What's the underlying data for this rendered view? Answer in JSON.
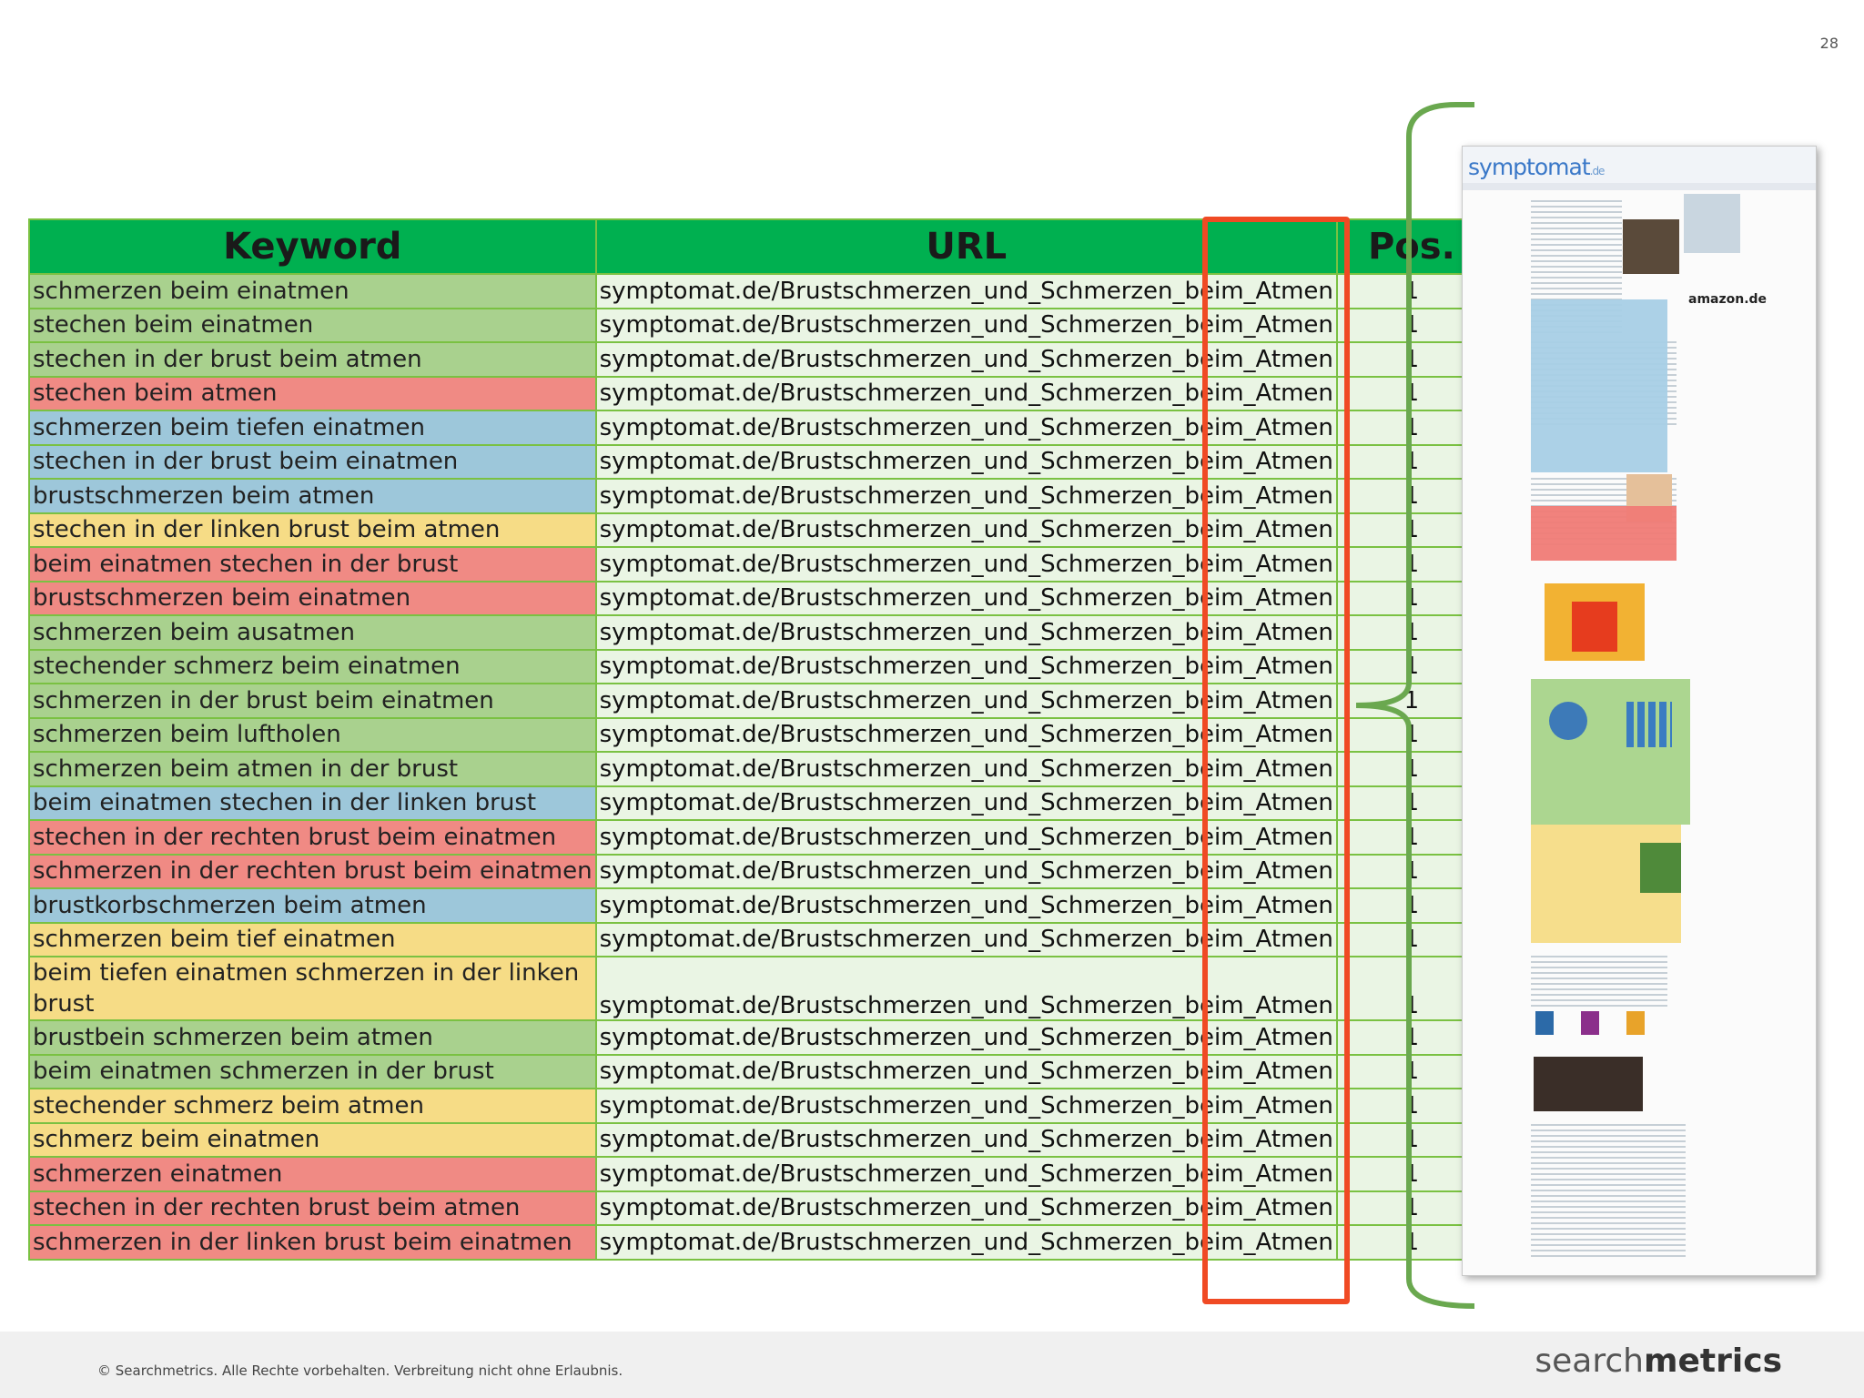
{
  "page_number": "28",
  "table": {
    "headers": {
      "keyword": "Keyword",
      "url": "URL",
      "pos": "Pos."
    },
    "rows": [
      {
        "keyword": "schmerzen beim einatmen",
        "url": "symptomat.de/Brustschmerzen_und_Schmerzen_beim_Atmen",
        "pos": "1",
        "color": "green"
      },
      {
        "keyword": "stechen beim einatmen",
        "url": "symptomat.de/Brustschmerzen_und_Schmerzen_beim_Atmen",
        "pos": "1",
        "color": "green"
      },
      {
        "keyword": "stechen in der brust beim atmen",
        "url": "symptomat.de/Brustschmerzen_und_Schmerzen_beim_Atmen",
        "pos": "1",
        "color": "green"
      },
      {
        "keyword": "stechen beim atmen",
        "url": "symptomat.de/Brustschmerzen_und_Schmerzen_beim_Atmen",
        "pos": "1",
        "color": "red"
      },
      {
        "keyword": "schmerzen beim tiefen einatmen",
        "url": "symptomat.de/Brustschmerzen_und_Schmerzen_beim_Atmen",
        "pos": "1",
        "color": "blue"
      },
      {
        "keyword": "stechen in der brust beim einatmen",
        "url": "symptomat.de/Brustschmerzen_und_Schmerzen_beim_Atmen",
        "pos": "1",
        "color": "blue"
      },
      {
        "keyword": "brustschmerzen beim atmen",
        "url": "symptomat.de/Brustschmerzen_und_Schmerzen_beim_Atmen",
        "pos": "1",
        "color": "blue"
      },
      {
        "keyword": "stechen in der linken brust beim atmen",
        "url": "symptomat.de/Brustschmerzen_und_Schmerzen_beim_Atmen",
        "pos": "1",
        "color": "yellow"
      },
      {
        "keyword": "beim einatmen stechen in der brust",
        "url": "symptomat.de/Brustschmerzen_und_Schmerzen_beim_Atmen",
        "pos": "1",
        "color": "red"
      },
      {
        "keyword": "brustschmerzen beim einatmen",
        "url": "symptomat.de/Brustschmerzen_und_Schmerzen_beim_Atmen",
        "pos": "1",
        "color": "red"
      },
      {
        "keyword": "schmerzen beim ausatmen",
        "url": "symptomat.de/Brustschmerzen_und_Schmerzen_beim_Atmen",
        "pos": "1",
        "color": "green"
      },
      {
        "keyword": "stechender schmerz beim einatmen",
        "url": "symptomat.de/Brustschmerzen_und_Schmerzen_beim_Atmen",
        "pos": "1",
        "color": "green"
      },
      {
        "keyword": "schmerzen in der brust beim einatmen",
        "url": "symptomat.de/Brustschmerzen_und_Schmerzen_beim_Atmen",
        "pos": "1",
        "color": "green"
      },
      {
        "keyword": "schmerzen beim luftholen",
        "url": "symptomat.de/Brustschmerzen_und_Schmerzen_beim_Atmen",
        "pos": "1",
        "color": "green"
      },
      {
        "keyword": "schmerzen beim atmen in der brust",
        "url": "symptomat.de/Brustschmerzen_und_Schmerzen_beim_Atmen",
        "pos": "1",
        "color": "green"
      },
      {
        "keyword": "beim einatmen stechen in der linken brust",
        "url": "symptomat.de/Brustschmerzen_und_Schmerzen_beim_Atmen",
        "pos": "1",
        "color": "blue"
      },
      {
        "keyword": "stechen in der rechten brust beim einatmen",
        "url": "symptomat.de/Brustschmerzen_und_Schmerzen_beim_Atmen",
        "pos": "1",
        "color": "red"
      },
      {
        "keyword": "schmerzen in der rechten brust beim einatmen",
        "url": "symptomat.de/Brustschmerzen_und_Schmerzen_beim_Atmen",
        "pos": "1",
        "color": "red"
      },
      {
        "keyword": "brustkorbschmerzen beim atmen",
        "url": "symptomat.de/Brustschmerzen_und_Schmerzen_beim_Atmen",
        "pos": "1",
        "color": "blue"
      },
      {
        "keyword": "schmerzen beim tief einatmen",
        "url": "symptomat.de/Brustschmerzen_und_Schmerzen_beim_Atmen",
        "pos": "1",
        "color": "yellow"
      },
      {
        "keyword": "beim tiefen einatmen schmerzen in der linken brust",
        "url": "symptomat.de/Brustschmerzen_und_Schmerzen_beim_Atmen",
        "pos": "1",
        "color": "yellow",
        "tall": true
      },
      {
        "keyword": "brustbein schmerzen beim atmen",
        "url": "symptomat.de/Brustschmerzen_und_Schmerzen_beim_Atmen",
        "pos": "1",
        "color": "green"
      },
      {
        "keyword": "beim einatmen schmerzen in der brust",
        "url": "symptomat.de/Brustschmerzen_und_Schmerzen_beim_Atmen",
        "pos": "1",
        "color": "green"
      },
      {
        "keyword": "stechender schmerz beim atmen",
        "url": "symptomat.de/Brustschmerzen_und_Schmerzen_beim_Atmen",
        "pos": "1",
        "color": "yellow"
      },
      {
        "keyword": "schmerz beim einatmen",
        "url": "symptomat.de/Brustschmerzen_und_Schmerzen_beim_Atmen",
        "pos": "1",
        "color": "yellow"
      },
      {
        "keyword": "schmerzen einatmen",
        "url": "symptomat.de/Brustschmerzen_und_Schmerzen_beim_Atmen",
        "pos": "1",
        "color": "red"
      },
      {
        "keyword": "stechen in der rechten brust beim atmen",
        "url": "symptomat.de/Brustschmerzen_und_Schmerzen_beim_Atmen",
        "pos": "1",
        "color": "red"
      },
      {
        "keyword": "schmerzen in der linken brust beim einatmen",
        "url": "symptomat.de/Brustschmerzen_und_Schmerzen_beim_Atmen",
        "pos": "1",
        "color": "red"
      }
    ]
  },
  "colors": {
    "header_green": "#00b050",
    "highlight_orange": "#f04a24",
    "brace_green": "#6aa84f",
    "row_green": "#a9d18e",
    "row_red": "#f08a84",
    "row_blue": "#9dc7da",
    "row_yellow": "#f6dc86"
  },
  "thumbnail": {
    "logo": "symptomat",
    "logo_suffix": ".de",
    "amazon_label": "amazon.de"
  },
  "footer": {
    "copyright": "© Searchmetrics. Alle Rechte vorbehalten. Verbreitung nicht ohne Erlaubnis.",
    "brand_light": "search",
    "brand_bold": "metrics"
  }
}
